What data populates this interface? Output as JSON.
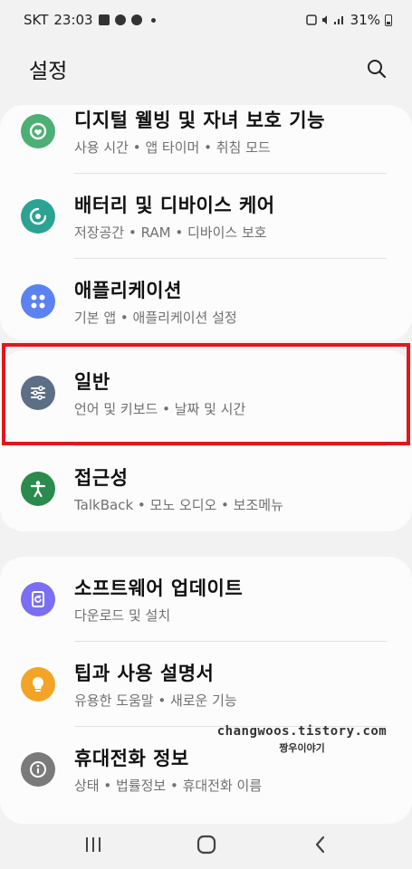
{
  "status_bar": {
    "carrier": "SKT",
    "time": "23:03",
    "battery": "31%"
  },
  "header": {
    "title": "설정"
  },
  "groups": [
    {
      "items": [
        {
          "title": "디지털 웰빙 및 자녀 보호 기능",
          "subtitle": "사용 시간 • 앱 타이머 • 취침 모드",
          "icon": "digital-wellbeing-icon",
          "color": "#4caf73"
        },
        {
          "title": "배터리 및 디바이스 케어",
          "subtitle": "저장공간 • RAM • 디바이스 보호",
          "icon": "device-care-icon",
          "color": "#2aa392"
        },
        {
          "title": "애플리케이션",
          "subtitle": "기본 앱 • 애플리케이션 설정",
          "icon": "apps-icon",
          "color": "#5a82f0"
        }
      ]
    },
    {
      "items": [
        {
          "title": "일반",
          "subtitle": "언어 및 키보드 • 날짜 및 시간",
          "icon": "general-sliders-icon",
          "color": "#5c6f86"
        },
        {
          "title": "접근성",
          "subtitle": "TalkBack • 모노 오디오 • 보조메뉴",
          "icon": "accessibility-icon",
          "color": "#2b8a4e"
        }
      ]
    },
    {
      "items": [
        {
          "title": "소프트웨어 업데이트",
          "subtitle": "다운로드 및 설치",
          "icon": "software-update-icon",
          "color": "#7b6ef0"
        },
        {
          "title": "팁과 사용 설명서",
          "subtitle": "유용한 도움말 • 새로운 기능",
          "icon": "tips-bulb-icon",
          "color": "#f3a325"
        },
        {
          "title": "휴대전화 정보",
          "subtitle": "상태 • 법률정보 • 휴대전화 이름",
          "icon": "phone-info-icon",
          "color": "#7a7a7a"
        }
      ]
    }
  ],
  "watermark": {
    "line1": "changwoos.tistory.com",
    "line2": "짱우이야기"
  },
  "highlight_color": "#e4161b"
}
